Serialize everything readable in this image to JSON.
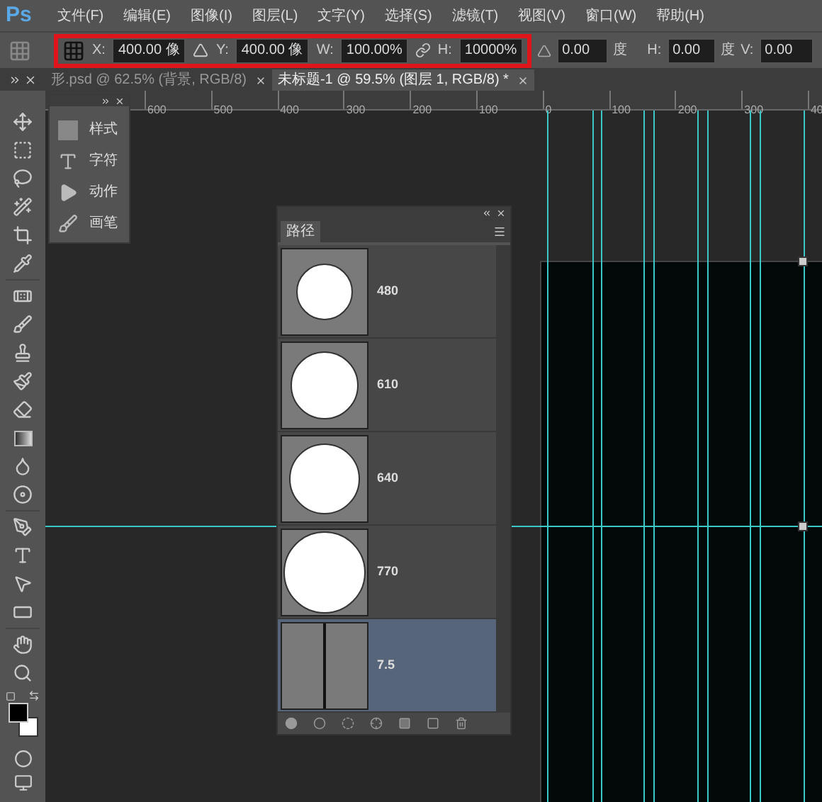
{
  "app_logo": "Ps",
  "menu": [
    "文件(F)",
    "编辑(E)",
    "图像(I)",
    "图层(L)",
    "文字(Y)",
    "选择(S)",
    "滤镜(T)",
    "视图(V)",
    "窗口(W)",
    "帮助(H)"
  ],
  "options_bar": {
    "x_label": "X:",
    "x_value": "400.00 像",
    "y_label": "Y:",
    "y_value": "400.00 像",
    "w_label": "W:",
    "w_value": "100.00%",
    "h_label": "H:",
    "h_value": "10000%",
    "rotate_value": "0.00",
    "rotate_unit": "度",
    "skew_h_label": "H:",
    "skew_h_value": "0.00",
    "skew_h_unit": "度",
    "skew_v_label": "V:",
    "skew_v_value": "0.00"
  },
  "document_tabs": [
    {
      "label": "形.psd @ 62.5% (背景, RGB/8)",
      "selected": false
    },
    {
      "label": "未标题-1 @ 59.5% (图层 1, RGB/8) *",
      "selected": true
    }
  ],
  "ruler_labels": [
    "600",
    "500",
    "400",
    "300",
    "200",
    "100",
    "0",
    "100",
    "200",
    "300",
    "40"
  ],
  "collapsed_panels": [
    {
      "kind": "styles",
      "label": "样式"
    },
    {
      "kind": "character",
      "label": "字符"
    },
    {
      "kind": "actions",
      "label": "动作"
    },
    {
      "kind": "brushes",
      "label": "画笔"
    }
  ],
  "paths_panel": {
    "tab": "路径",
    "rows": [
      {
        "kind": "circle",
        "label": "480",
        "selected": false
      },
      {
        "kind": "circle",
        "label": "610",
        "selected": false
      },
      {
        "kind": "circle",
        "label": "640",
        "selected": false
      },
      {
        "kind": "circle",
        "label": "770",
        "selected": false
      },
      {
        "kind": "line",
        "label": "7.5",
        "selected": true
      }
    ]
  }
}
